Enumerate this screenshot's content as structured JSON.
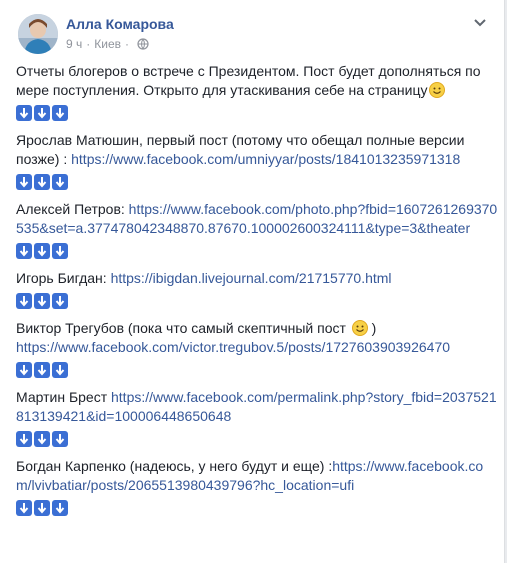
{
  "post": {
    "author": "Алла Комарова",
    "time": "9 ч",
    "dot": "·",
    "location": "Киев",
    "dot2": "·",
    "icons": {
      "avatar": "avatar-photo",
      "audience": "globe-icon",
      "options": "chevron-down-icon",
      "arrow": "down-arrow-emoji",
      "smile": "smiling-face-emoji"
    },
    "intro": "Отчеты блогеров о встрече с Президентом. Пост будет дополняться по мере поступления. Открыто для утаскивания себе на страницу",
    "entries": [
      {
        "text": "Ярослав Матюшин, первый пост (потому что обещал полные версии позже) : ",
        "link": "https://www.facebook.com/umniyyar/posts/1841013235971318",
        "after": ""
      },
      {
        "text": "Алексей Петров: ",
        "link": "https://www.facebook.com/photo.php?fbid=1607261269370535&set=a.377478042348870.87670.100002600324111&type=3&theater",
        "after": ""
      },
      {
        "text": "Игорь Бигдан: ",
        "link": "https://ibigdan.livejournal.com/21715770.html",
        "after": ""
      },
      {
        "text": "Виктор Трегубов (пока что самый скептичный пост ",
        "after_smile": " )",
        "link": "https://www.facebook.com/victor.tregubov.5/posts/1727603903926470"
      },
      {
        "text": "Мартин Брест ",
        "link": "https://www.facebook.com/permalink.php?story_fbid=2037521813139421&id=100006448650648",
        "after": ""
      },
      {
        "text": "Богдан Карпенко (надеюсь, у него будут и еще) :",
        "link": "https://www.facebook.com/lvivbatiar/posts/2065513980439796?hc_location=ufi",
        "after": ""
      }
    ]
  }
}
